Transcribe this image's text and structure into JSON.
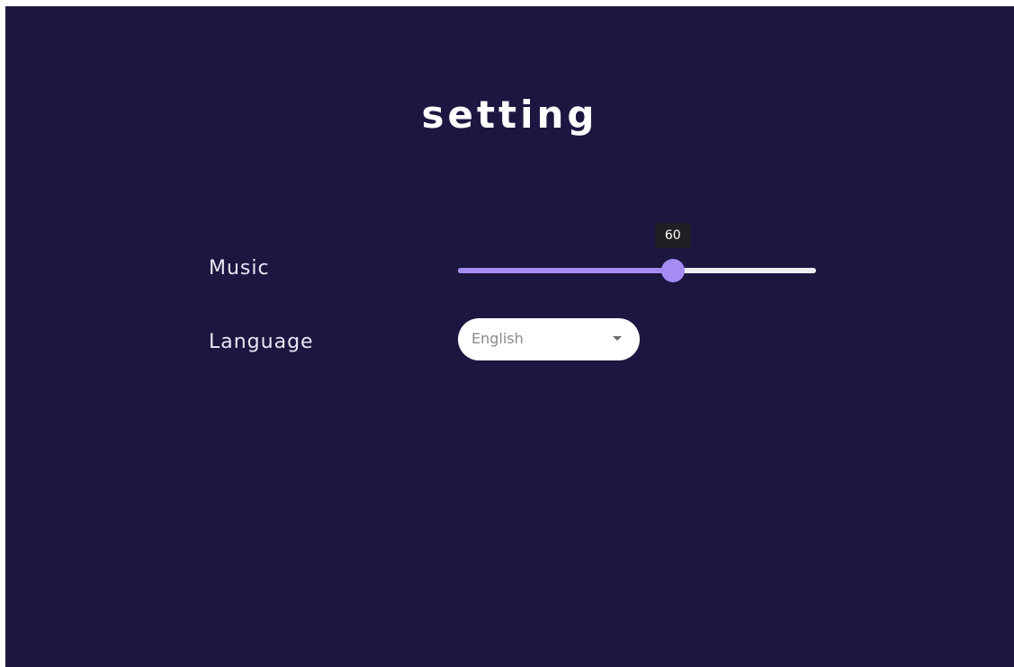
{
  "page": {
    "title": "setting",
    "background_color": "#1c1740"
  },
  "music": {
    "label": "Music",
    "value": 60,
    "value_text": "60",
    "min": 0,
    "max": 100,
    "accent_color": "#a58cf2"
  },
  "language": {
    "label": "Language",
    "selected": "English",
    "icon": "caret-down-icon"
  }
}
